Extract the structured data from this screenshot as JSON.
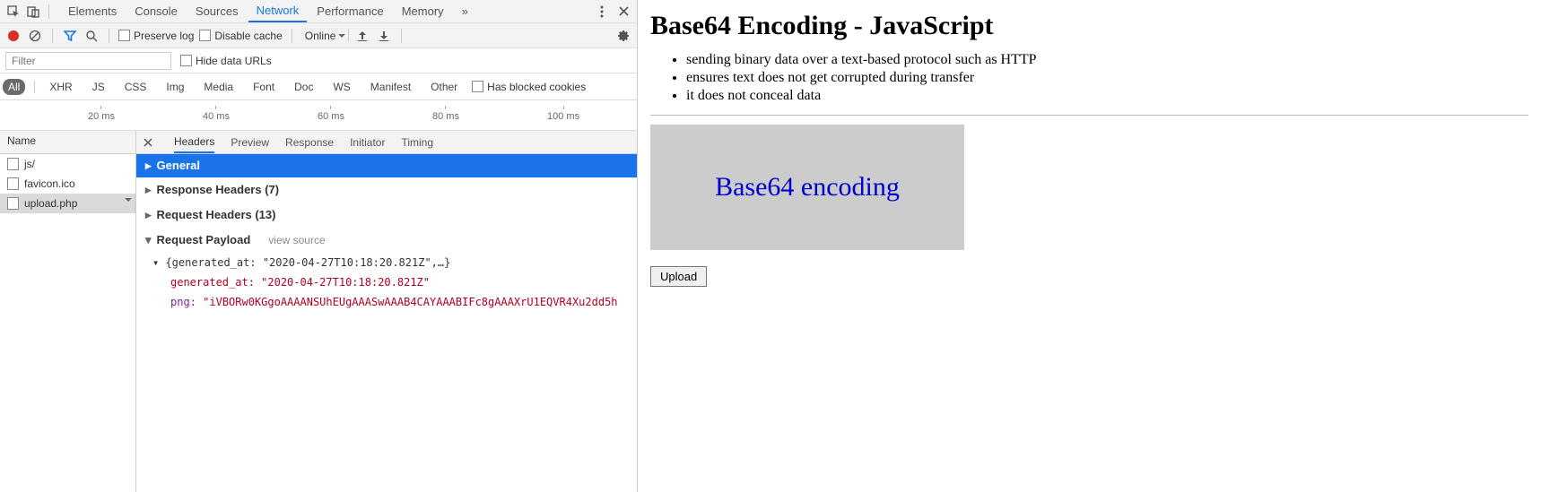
{
  "devtools": {
    "tabs": [
      "Elements",
      "Console",
      "Sources",
      "Network",
      "Performance",
      "Memory"
    ],
    "active_tab": "Network",
    "toolbar": {
      "preserve_log": "Preserve log",
      "disable_cache": "Disable cache",
      "throttle": "Online"
    },
    "filter": {
      "placeholder": "Filter",
      "hide_urls": "Hide data URLs"
    },
    "type_filters": [
      "All",
      "XHR",
      "JS",
      "CSS",
      "Img",
      "Media",
      "Font",
      "Doc",
      "WS",
      "Manifest",
      "Other"
    ],
    "has_blocked": "Has blocked cookies",
    "timeline_ticks": [
      "20 ms",
      "40 ms",
      "60 ms",
      "80 ms",
      "100 ms"
    ],
    "names_header": "Name",
    "requests": [
      {
        "name": "js/"
      },
      {
        "name": "favicon.ico"
      },
      {
        "name": "upload.php",
        "selected": true
      }
    ],
    "detail_tabs": [
      "Headers",
      "Preview",
      "Response",
      "Initiator",
      "Timing"
    ],
    "detail_active": "Headers",
    "sections": {
      "general": "General",
      "response_headers": "Response Headers (7)",
      "request_headers": "Request Headers (13)",
      "request_payload": "Request Payload",
      "view_source": "view source"
    },
    "payload": {
      "summary": "{generated_at: \"2020-04-27T10:18:20.821Z\",…}",
      "generated_at_key": "generated_at:",
      "generated_at_val": "\"2020-04-27T10:18:20.821Z\"",
      "png_key": "png:",
      "png_val": "\"iVBORw0KGgoAAAANSUhEUgAAASwAAAB4CAYAAABIFc8gAAAXrU1EQVR4Xu2dd5h"
    }
  },
  "page": {
    "title": "Base64 Encoding - JavaScript",
    "bullets": [
      "sending binary data over a text-based protocol such as HTTP",
      "ensures text does not get corrupted during transfer",
      "it does not conceal data"
    ],
    "canvas_text": "Base64 encoding",
    "upload_label": "Upload"
  }
}
